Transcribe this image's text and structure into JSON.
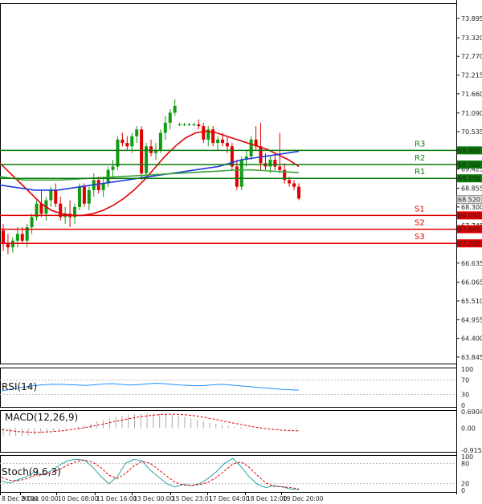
{
  "chart_data": [
    {
      "type": "candlestick",
      "panel": "price",
      "ylim": [
        63.7,
        74.3
      ],
      "y_ticks": [
        "73.895",
        "73.320",
        "72.770",
        "72.215",
        "71.660",
        "71.090",
        "70.535",
        "69.980",
        "69.425",
        "68.855",
        "68.300",
        "67.745",
        "67.175",
        "66.635",
        "66.065",
        "65.510",
        "64.955",
        "64.400",
        "63.845"
      ],
      "x_tick_labels": [
        "8 Dec 20:00",
        "9 Dec 00:00",
        "10 Dec 08:00",
        "11 Dec 16:00",
        "13 Dec 00:00",
        "15 Dec 23:01",
        "17 Dec 04:00",
        "18 Dec 12:00",
        "19 Dec 20:00"
      ],
      "current_price": {
        "label": "68.520",
        "value": 68.52
      },
      "levels": [
        {
          "name": "R3",
          "value": 69.98,
          "label": "69.980",
          "color": "#0a7a0a"
        },
        {
          "name": "R2",
          "value": 69.56,
          "label": "69.560",
          "color": "#0a7a0a"
        },
        {
          "name": "R1",
          "value": 69.15,
          "label": "69.150",
          "color": "#0a7a0a"
        },
        {
          "name": "S1",
          "value": 68.05,
          "label": "68.050",
          "color": "#e00000"
        },
        {
          "name": "S2",
          "value": 67.64,
          "label": "67.640",
          "color": "#e00000"
        },
        {
          "name": "S3",
          "value": 67.22,
          "label": "67.220",
          "color": "#e00000"
        }
      ],
      "candles": [
        {
          "o": 67.6,
          "h": 67.8,
          "l": 67.0,
          "c": 67.2
        },
        {
          "o": 67.2,
          "h": 67.5,
          "l": 66.9,
          "c": 67.1
        },
        {
          "o": 67.1,
          "h": 67.4,
          "l": 66.95,
          "c": 67.3
        },
        {
          "o": 67.3,
          "h": 67.7,
          "l": 67.1,
          "c": 67.5
        },
        {
          "o": 67.5,
          "h": 67.7,
          "l": 67.2,
          "c": 67.3
        },
        {
          "o": 67.3,
          "h": 67.8,
          "l": 67.1,
          "c": 67.7
        },
        {
          "o": 67.7,
          "h": 68.1,
          "l": 67.5,
          "c": 68.0
        },
        {
          "o": 68.0,
          "h": 68.5,
          "l": 67.9,
          "c": 68.4
        },
        {
          "o": 68.4,
          "h": 68.8,
          "l": 68.0,
          "c": 68.1
        },
        {
          "o": 68.1,
          "h": 68.6,
          "l": 67.9,
          "c": 68.5
        },
        {
          "o": 68.5,
          "h": 68.9,
          "l": 68.3,
          "c": 68.8
        },
        {
          "o": 68.8,
          "h": 69.0,
          "l": 68.3,
          "c": 68.4
        },
        {
          "o": 68.4,
          "h": 68.6,
          "l": 67.9,
          "c": 68.0
        },
        {
          "o": 68.0,
          "h": 68.3,
          "l": 67.8,
          "c": 68.1
        },
        {
          "o": 68.1,
          "h": 68.5,
          "l": 67.7,
          "c": 68.0
        },
        {
          "o": 68.0,
          "h": 68.4,
          "l": 67.8,
          "c": 68.3
        },
        {
          "o": 68.3,
          "h": 69.0,
          "l": 68.2,
          "c": 68.9
        },
        {
          "o": 68.9,
          "h": 69.0,
          "l": 68.3,
          "c": 68.4
        },
        {
          "o": 68.4,
          "h": 68.9,
          "l": 68.2,
          "c": 68.8
        },
        {
          "o": 68.8,
          "h": 69.3,
          "l": 68.6,
          "c": 69.1
        },
        {
          "o": 69.1,
          "h": 69.2,
          "l": 68.7,
          "c": 68.8
        },
        {
          "o": 68.8,
          "h": 69.2,
          "l": 68.6,
          "c": 69.0
        },
        {
          "o": 69.0,
          "h": 69.5,
          "l": 68.9,
          "c": 69.4
        },
        {
          "o": 69.4,
          "h": 69.7,
          "l": 69.2,
          "c": 69.5
        },
        {
          "o": 69.5,
          "h": 70.4,
          "l": 69.4,
          "c": 70.3
        },
        {
          "o": 70.3,
          "h": 70.5,
          "l": 70.1,
          "c": 70.2
        },
        {
          "o": 70.2,
          "h": 70.4,
          "l": 70.0,
          "c": 70.1
        },
        {
          "o": 70.1,
          "h": 70.5,
          "l": 69.9,
          "c": 70.4
        },
        {
          "o": 70.4,
          "h": 70.7,
          "l": 70.2,
          "c": 70.6
        },
        {
          "o": 70.6,
          "h": 70.7,
          "l": 69.1,
          "c": 69.3
        },
        {
          "o": 69.3,
          "h": 70.2,
          "l": 69.2,
          "c": 70.1
        },
        {
          "o": 70.1,
          "h": 70.3,
          "l": 69.8,
          "c": 69.9
        },
        {
          "o": 69.9,
          "h": 70.2,
          "l": 69.7,
          "c": 70.0
        },
        {
          "o": 70.0,
          "h": 70.6,
          "l": 69.9,
          "c": 70.5
        },
        {
          "o": 70.5,
          "h": 71.0,
          "l": 70.3,
          "c": 70.8
        },
        {
          "o": 70.8,
          "h": 71.2,
          "l": 70.6,
          "c": 71.1
        },
        {
          "o": 71.1,
          "h": 71.5,
          "l": 71.0,
          "c": 71.3
        },
        {
          "o": 70.75,
          "h": 70.8,
          "l": 70.7,
          "c": 70.75
        },
        {
          "o": 70.75,
          "h": 70.8,
          "l": 70.7,
          "c": 70.75
        },
        {
          "o": 70.75,
          "h": 70.8,
          "l": 70.7,
          "c": 70.75
        },
        {
          "o": 70.75,
          "h": 70.8,
          "l": 70.7,
          "c": 70.75
        },
        {
          "o": 70.75,
          "h": 70.9,
          "l": 70.6,
          "c": 70.7
        },
        {
          "o": 70.7,
          "h": 70.8,
          "l": 70.2,
          "c": 70.3
        },
        {
          "o": 70.3,
          "h": 70.7,
          "l": 70.1,
          "c": 70.6
        },
        {
          "o": 70.6,
          "h": 70.7,
          "l": 70.1,
          "c": 70.2
        },
        {
          "o": 70.2,
          "h": 70.4,
          "l": 70.0,
          "c": 70.3
        },
        {
          "o": 70.3,
          "h": 70.5,
          "l": 70.1,
          "c": 70.2
        },
        {
          "o": 70.2,
          "h": 70.4,
          "l": 69.9,
          "c": 70.1
        },
        {
          "o": 70.1,
          "h": 70.2,
          "l": 69.4,
          "c": 69.5
        },
        {
          "o": 69.5,
          "h": 69.7,
          "l": 68.8,
          "c": 68.9
        },
        {
          "o": 68.9,
          "h": 69.8,
          "l": 68.8,
          "c": 69.7
        },
        {
          "o": 69.7,
          "h": 70.0,
          "l": 69.5,
          "c": 69.8
        },
        {
          "o": 69.8,
          "h": 70.4,
          "l": 69.7,
          "c": 70.3
        },
        {
          "o": 70.3,
          "h": 70.7,
          "l": 70.0,
          "c": 70.1
        },
        {
          "o": 70.1,
          "h": 70.8,
          "l": 69.4,
          "c": 69.6
        },
        {
          "o": 69.6,
          "h": 69.9,
          "l": 69.4,
          "c": 69.5
        },
        {
          "o": 69.5,
          "h": 69.8,
          "l": 69.3,
          "c": 69.7
        },
        {
          "o": 69.7,
          "h": 69.9,
          "l": 69.4,
          "c": 69.5
        },
        {
          "o": 69.5,
          "h": 70.5,
          "l": 69.3,
          "c": 69.4
        },
        {
          "o": 69.4,
          "h": 69.6,
          "l": 69.0,
          "c": 69.1
        },
        {
          "o": 69.1,
          "h": 69.2,
          "l": 68.9,
          "c": 69.0
        },
        {
          "o": 69.0,
          "h": 69.1,
          "l": 68.8,
          "c": 68.9
        },
        {
          "o": 68.9,
          "h": 69.0,
          "l": 68.5,
          "c": 68.55
        }
      ],
      "series": [
        {
          "color": "#e00000",
          "values": [
            69.6,
            69.3,
            69.0,
            68.7,
            68.4,
            68.2,
            68.1,
            68.05,
            68.05,
            68.1,
            68.2,
            68.35,
            68.55,
            68.8,
            69.1,
            69.45,
            69.8,
            70.1,
            70.35,
            70.5,
            70.55,
            70.5,
            70.4,
            70.3,
            70.2,
            70.1,
            70.0,
            69.85,
            69.7,
            69.5
          ]
        },
        {
          "color": "#1e3cd8",
          "values": [
            68.95,
            68.9,
            68.85,
            68.8,
            68.8,
            68.8,
            68.85,
            68.9,
            68.95,
            69.0,
            69.05,
            69.1,
            69.15,
            69.2,
            69.25,
            69.3,
            69.35,
            69.4,
            69.45,
            69.5,
            69.6,
            69.7,
            69.75,
            69.8,
            69.85,
            69.9,
            69.95
          ]
        },
        {
          "color": "#3aa53a",
          "values": [
            69.2,
            69.15,
            69.1,
            69.1,
            69.1,
            69.1,
            69.12,
            69.14,
            69.16,
            69.18,
            69.2,
            69.22,
            69.24,
            69.26,
            69.28,
            69.3,
            69.32,
            69.34,
            69.36,
            69.38,
            69.4,
            69.4,
            69.38,
            69.36,
            69.34,
            69.32
          ]
        }
      ]
    },
    {
      "type": "line",
      "panel": "rsi",
      "title": "RSI(14)",
      "ylim": [
        0,
        100
      ],
      "y_ticks": [
        "100",
        "70",
        "30",
        "0"
      ],
      "series": [
        {
          "color": "#1e90ff",
          "values": [
            40,
            44,
            48,
            52,
            55,
            57,
            58,
            58,
            57,
            56,
            55,
            57,
            59,
            60,
            58,
            56,
            57,
            59,
            61,
            60,
            58,
            56,
            55,
            54,
            55,
            57,
            58,
            56,
            54,
            52,
            50,
            48,
            46,
            44,
            43,
            42
          ]
        }
      ]
    },
    {
      "type": "bar",
      "panel": "macd",
      "title": "MACD(12,26,9)",
      "ylim": [
        -0.9153,
        0.6904
      ],
      "y_ticks": [
        "0.6904",
        "0.00",
        "-0.9153"
      ],
      "histogram": [
        -0.3,
        -0.32,
        -0.33,
        -0.32,
        -0.3,
        -0.27,
        -0.23,
        -0.19,
        -0.14,
        -0.09,
        -0.04,
        0.01,
        0.07,
        0.14,
        0.21,
        0.28,
        0.35,
        0.41,
        0.47,
        0.52,
        0.56,
        0.59,
        0.61,
        0.62,
        0.62,
        0.61,
        0.59,
        0.56,
        0.52,
        0.47,
        0.41,
        0.35,
        0.29,
        0.23,
        0.18,
        0.14,
        0.1,
        0.07,
        0.05,
        0.03,
        0.01,
        0.0,
        -0.01,
        -0.02,
        -0.03,
        -0.04,
        -0.05,
        -0.06
      ],
      "series": [
        {
          "color": "#e00000",
          "values": [
            -0.05,
            -0.1,
            -0.14,
            -0.16,
            -0.17,
            -0.16,
            -0.14,
            -0.11,
            -0.07,
            -0.02,
            0.04,
            0.11,
            0.18,
            0.26,
            0.33,
            0.4,
            0.46,
            0.51,
            0.55,
            0.58,
            0.59,
            0.58,
            0.55,
            0.51,
            0.45,
            0.38,
            0.31,
            0.24,
            0.17,
            0.1,
            0.04,
            -0.01,
            -0.05,
            -0.08,
            -0.1,
            -0.11
          ]
        }
      ]
    },
    {
      "type": "line",
      "panel": "stoch",
      "title": "Stoch(9,6,3)",
      "ylim": [
        0,
        100
      ],
      "y_ticks": [
        "100",
        "80",
        "20",
        "0"
      ],
      "series": [
        {
          "color": "#2aa2a2",
          "values": [
            28,
            22,
            32,
            40,
            55,
            45,
            58,
            75,
            88,
            92,
            90,
            70,
            42,
            20,
            40,
            80,
            92,
            88,
            60,
            40,
            20,
            10,
            18,
            14,
            20,
            35,
            55,
            80,
            95,
            70,
            40,
            18,
            8,
            14,
            10,
            4,
            2
          ]
        },
        {
          "color": "#e00000",
          "values": [
            38,
            30,
            28,
            34,
            44,
            48,
            52,
            62,
            75,
            85,
            90,
            84,
            68,
            45,
            35,
            50,
            72,
            86,
            80,
            62,
            42,
            24,
            16,
            15,
            17,
            24,
            38,
            58,
            78,
            84,
            68,
            44,
            22,
            12,
            11,
            8,
            4
          ]
        }
      ]
    }
  ]
}
